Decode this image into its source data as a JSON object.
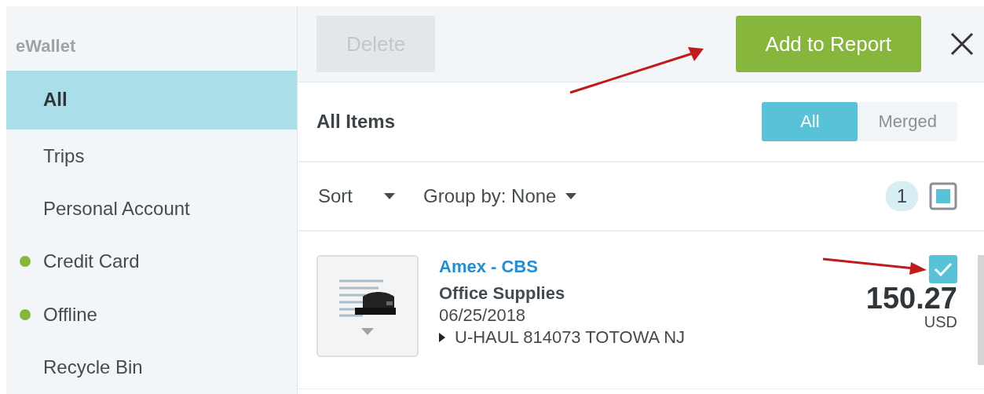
{
  "sidebar": {
    "title": "eWallet",
    "items": [
      {
        "label": "All",
        "selected": true
      },
      {
        "label": "Trips",
        "selected": false
      },
      {
        "label": "Personal Account",
        "selected": false
      },
      {
        "label": "Credit Card",
        "selected": false,
        "color": "#86b73c"
      },
      {
        "label": "Offline",
        "selected": false,
        "color": "#86b73c"
      },
      {
        "label": "Recycle Bin",
        "selected": false
      }
    ]
  },
  "toolbar": {
    "delete": {
      "label": "Delete",
      "disabled": true
    },
    "add_to_report": {
      "label": "Add to Report",
      "disabled": false
    }
  },
  "list": {
    "title": "All Items",
    "filters": [
      {
        "label": "All",
        "selected": true
      },
      {
        "label": "Merged",
        "selected": false
      }
    ],
    "sort": "Sort",
    "group_by": "Group by: None",
    "count": "1",
    "select_all": {
      "checked": true
    },
    "items": [
      {
        "card": "Amex - CBS",
        "category": "Office Supplies",
        "date": "06/25/2018",
        "merchant": "U-HAUL 814073 TOTOWA NJ",
        "amount": "150.27",
        "currency": "USD",
        "checked": true
      }
    ]
  }
}
